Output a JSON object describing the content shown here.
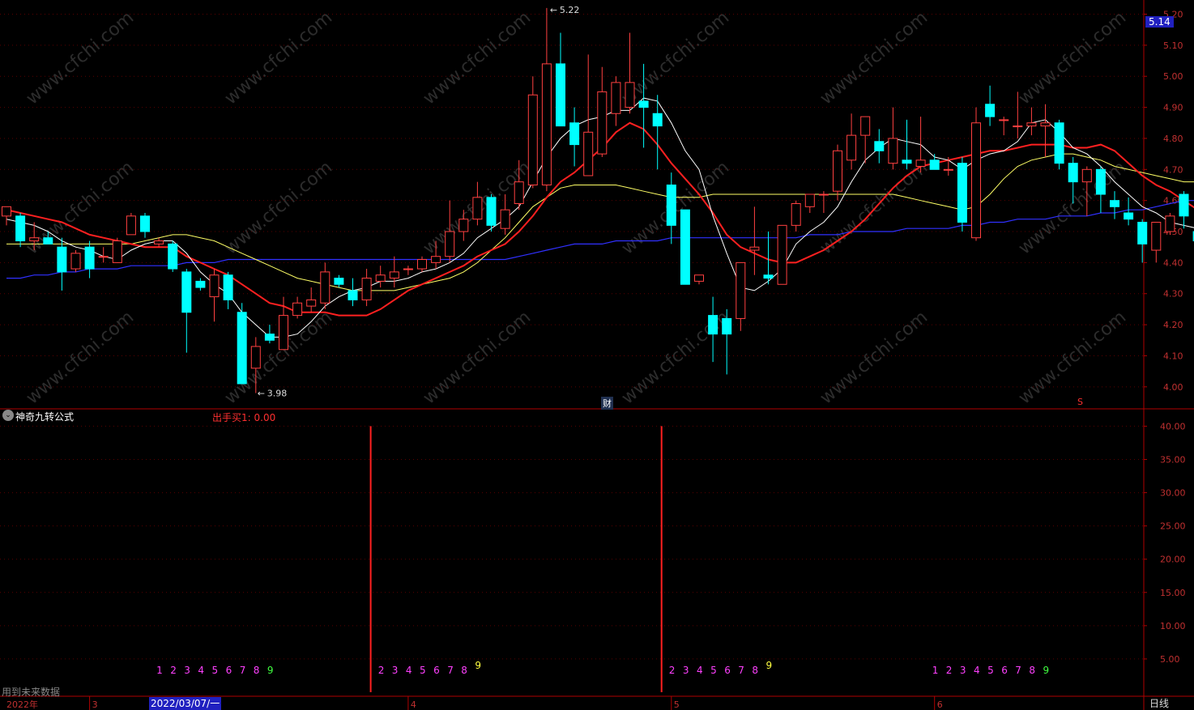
{
  "app": {
    "indicator_name": "神奇九转公式",
    "indicator_value_label": "出手买1:",
    "indicator_value": "0.00",
    "future_data_note": "用到未来数据",
    "period": "日线",
    "cursor_date": "2022/03/07/一",
    "cursor_price": "5.14",
    "max_label": "5.22",
    "min_label": "3.98",
    "fin_marker": "财",
    "s_marker": "S"
  },
  "colors": {
    "background": "#000000",
    "up": "#ff4040",
    "down": "#00ffff",
    "ma5": "#ffffff",
    "ma10": "#ff2020",
    "ma20": "#ffff66",
    "ma60": "#3030ff",
    "axis": "#b00000",
    "watermark": "#2c2c2c"
  },
  "watermark": "www.cfchi.com",
  "chart_data": {
    "type": "candlestick",
    "price_axis": {
      "min": 3.95,
      "max": 5.23,
      "ticks": [
        "4.00",
        "4.10",
        "4.20",
        "4.30",
        "4.40",
        "4.50",
        "4.60",
        "4.70",
        "4.80",
        "4.90",
        "5.00",
        "5.10",
        "5.20"
      ]
    },
    "indicator_axis": {
      "min": 0,
      "max": 42,
      "ticks": [
        "5.00",
        "10.00",
        "15.00",
        "20.00",
        "25.00",
        "30.00",
        "35.00",
        "40.00"
      ]
    },
    "x_labels": [
      "2022年",
      "3",
      "4",
      "5",
      "6"
    ],
    "candles": [
      {
        "o": 4.55,
        "h": 4.58,
        "l": 4.52,
        "c": 4.58
      },
      {
        "o": 4.55,
        "h": 4.56,
        "l": 4.45,
        "c": 4.47
      },
      {
        "o": 4.47,
        "h": 4.53,
        "l": 4.44,
        "c": 4.48
      },
      {
        "o": 4.48,
        "h": 4.5,
        "l": 4.46,
        "c": 4.46
      },
      {
        "o": 4.45,
        "h": 4.48,
        "l": 4.31,
        "c": 4.37
      },
      {
        "o": 4.38,
        "h": 4.44,
        "l": 4.37,
        "c": 4.43
      },
      {
        "o": 4.45,
        "h": 4.47,
        "l": 4.35,
        "c": 4.38
      },
      {
        "o": 4.42,
        "h": 4.45,
        "l": 4.4,
        "c": 4.42
      },
      {
        "o": 4.4,
        "h": 4.48,
        "l": 4.4,
        "c": 4.47
      },
      {
        "o": 4.49,
        "h": 4.56,
        "l": 4.49,
        "c": 4.55
      },
      {
        "o": 4.55,
        "h": 4.56,
        "l": 4.48,
        "c": 4.5
      },
      {
        "o": 4.46,
        "h": 4.48,
        "l": 4.45,
        "c": 4.47
      },
      {
        "o": 4.46,
        "h": 4.47,
        "l": 4.37,
        "c": 4.38
      },
      {
        "o": 4.37,
        "h": 4.38,
        "l": 4.11,
        "c": 4.24
      },
      {
        "o": 4.34,
        "h": 4.35,
        "l": 4.31,
        "c": 4.32
      },
      {
        "o": 4.29,
        "h": 4.38,
        "l": 4.21,
        "c": 4.36
      },
      {
        "o": 4.36,
        "h": 4.37,
        "l": 4.25,
        "c": 4.28
      },
      {
        "o": 4.24,
        "h": 4.27,
        "l": 4.01,
        "c": 4.01
      },
      {
        "o": 4.06,
        "h": 4.16,
        "l": 3.98,
        "c": 4.13
      },
      {
        "o": 4.17,
        "h": 4.2,
        "l": 4.14,
        "c": 4.15
      },
      {
        "o": 4.12,
        "h": 4.29,
        "l": 4.12,
        "c": 4.23
      },
      {
        "o": 4.23,
        "h": 4.29,
        "l": 4.22,
        "c": 4.27
      },
      {
        "o": 4.26,
        "h": 4.32,
        "l": 4.24,
        "c": 4.28
      },
      {
        "o": 4.27,
        "h": 4.4,
        "l": 4.25,
        "c": 4.37
      },
      {
        "o": 4.35,
        "h": 4.36,
        "l": 4.32,
        "c": 4.33
      },
      {
        "o": 4.31,
        "h": 4.35,
        "l": 4.26,
        "c": 4.28
      },
      {
        "o": 4.28,
        "h": 4.38,
        "l": 4.26,
        "c": 4.35
      },
      {
        "o": 4.34,
        "h": 4.39,
        "l": 4.32,
        "c": 4.36
      },
      {
        "o": 4.35,
        "h": 4.42,
        "l": 4.32,
        "c": 4.37
      },
      {
        "o": 4.38,
        "h": 4.39,
        "l": 4.36,
        "c": 4.38
      },
      {
        "o": 4.38,
        "h": 4.42,
        "l": 4.37,
        "c": 4.41
      },
      {
        "o": 4.4,
        "h": 4.47,
        "l": 4.38,
        "c": 4.42
      },
      {
        "o": 4.42,
        "h": 4.6,
        "l": 4.4,
        "c": 4.5
      },
      {
        "o": 4.5,
        "h": 4.57,
        "l": 4.47,
        "c": 4.54
      },
      {
        "o": 4.54,
        "h": 4.66,
        "l": 4.52,
        "c": 4.61
      },
      {
        "o": 4.61,
        "h": 4.62,
        "l": 4.5,
        "c": 4.52
      },
      {
        "o": 4.51,
        "h": 4.62,
        "l": 4.49,
        "c": 4.57
      },
      {
        "o": 4.59,
        "h": 4.73,
        "l": 4.57,
        "c": 4.66
      },
      {
        "o": 4.65,
        "h": 5.0,
        "l": 4.64,
        "c": 4.94
      },
      {
        "o": 4.65,
        "h": 5.22,
        "l": 4.63,
        "c": 5.04
      },
      {
        "o": 5.04,
        "h": 5.14,
        "l": 4.85,
        "c": 4.84
      },
      {
        "o": 4.85,
        "h": 4.9,
        "l": 4.71,
        "c": 4.78
      },
      {
        "o": 4.68,
        "h": 5.07,
        "l": 4.68,
        "c": 4.82
      },
      {
        "o": 4.75,
        "h": 5.03,
        "l": 4.74,
        "c": 4.95
      },
      {
        "o": 4.88,
        "h": 5.0,
        "l": 4.84,
        "c": 4.98
      },
      {
        "o": 4.9,
        "h": 5.14,
        "l": 4.88,
        "c": 4.98
      },
      {
        "o": 4.92,
        "h": 5.04,
        "l": 4.77,
        "c": 4.9
      },
      {
        "o": 4.88,
        "h": 4.94,
        "l": 4.7,
        "c": 4.84
      },
      {
        "o": 4.65,
        "h": 4.69,
        "l": 4.46,
        "c": 4.52
      },
      {
        "o": 4.57,
        "h": 4.57,
        "l": 4.33,
        "c": 4.33
      },
      {
        "o": 4.34,
        "h": 4.36,
        "l": 4.33,
        "c": 4.36
      },
      {
        "o": 4.23,
        "h": 4.29,
        "l": 4.08,
        "c": 4.17
      },
      {
        "o": 4.22,
        "h": 4.25,
        "l": 4.04,
        "c": 4.17
      },
      {
        "o": 4.22,
        "h": 4.4,
        "l": 4.18,
        "c": 4.4
      },
      {
        "o": 4.44,
        "h": 4.58,
        "l": 4.36,
        "c": 4.45
      },
      {
        "o": 4.36,
        "h": 4.5,
        "l": 4.33,
        "c": 4.35
      },
      {
        "o": 4.33,
        "h": 4.52,
        "l": 4.33,
        "c": 4.52
      },
      {
        "o": 4.52,
        "h": 4.6,
        "l": 4.5,
        "c": 4.59
      },
      {
        "o": 4.58,
        "h": 4.62,
        "l": 4.56,
        "c": 4.62
      },
      {
        "o": 4.62,
        "h": 4.63,
        "l": 4.56,
        "c": 4.62
      },
      {
        "o": 4.63,
        "h": 4.78,
        "l": 4.6,
        "c": 4.76
      },
      {
        "o": 4.73,
        "h": 4.88,
        "l": 4.7,
        "c": 4.81
      },
      {
        "o": 4.81,
        "h": 4.87,
        "l": 4.72,
        "c": 4.87
      },
      {
        "o": 4.79,
        "h": 4.83,
        "l": 4.72,
        "c": 4.76
      },
      {
        "o": 4.72,
        "h": 4.9,
        "l": 4.7,
        "c": 4.8
      },
      {
        "o": 4.73,
        "h": 4.86,
        "l": 4.7,
        "c": 4.72
      },
      {
        "o": 4.71,
        "h": 4.87,
        "l": 4.69,
        "c": 4.73
      },
      {
        "o": 4.73,
        "h": 4.75,
        "l": 4.7,
        "c": 4.7
      },
      {
        "o": 4.7,
        "h": 4.74,
        "l": 4.68,
        "c": 4.7
      },
      {
        "o": 4.72,
        "h": 4.74,
        "l": 4.5,
        "c": 4.53
      },
      {
        "o": 4.48,
        "h": 4.9,
        "l": 4.47,
        "c": 4.85
      },
      {
        "o": 4.91,
        "h": 4.97,
        "l": 4.84,
        "c": 4.87
      },
      {
        "o": 4.86,
        "h": 4.87,
        "l": 4.81,
        "c": 4.86
      },
      {
        "o": 4.84,
        "h": 4.95,
        "l": 4.8,
        "c": 4.84
      },
      {
        "o": 4.84,
        "h": 4.9,
        "l": 4.81,
        "c": 4.85
      },
      {
        "o": 4.84,
        "h": 4.91,
        "l": 4.74,
        "c": 4.85
      },
      {
        "o": 4.85,
        "h": 4.86,
        "l": 4.7,
        "c": 4.72
      },
      {
        "o": 4.72,
        "h": 4.74,
        "l": 4.59,
        "c": 4.66
      },
      {
        "o": 4.66,
        "h": 4.71,
        "l": 4.55,
        "c": 4.7
      },
      {
        "o": 4.7,
        "h": 4.71,
        "l": 4.56,
        "c": 4.62
      },
      {
        "o": 4.6,
        "h": 4.63,
        "l": 4.54,
        "c": 4.58
      },
      {
        "o": 4.56,
        "h": 4.61,
        "l": 4.52,
        "c": 4.54
      },
      {
        "o": 4.53,
        "h": 4.54,
        "l": 4.4,
        "c": 4.46
      },
      {
        "o": 4.44,
        "h": 4.53,
        "l": 4.4,
        "c": 4.53
      },
      {
        "o": 4.5,
        "h": 4.56,
        "l": 4.49,
        "c": 4.55
      },
      {
        "o": 4.62,
        "h": 4.63,
        "l": 4.51,
        "c": 4.55
      },
      {
        "o": 4.5,
        "h": 4.53,
        "l": 4.47,
        "c": 4.47
      }
    ],
    "ma5": [
      4.54,
      4.53,
      4.52,
      4.5,
      4.47,
      4.45,
      4.44,
      4.42,
      4.41,
      4.44,
      4.46,
      4.47,
      4.47,
      4.43,
      4.37,
      4.33,
      4.3,
      4.24,
      4.2,
      4.16,
      4.16,
      4.17,
      4.21,
      4.26,
      4.29,
      4.31,
      4.32,
      4.34,
      4.34,
      4.35,
      4.37,
      4.38,
      4.4,
      4.43,
      4.48,
      4.51,
      4.54,
      4.58,
      4.66,
      4.74,
      4.8,
      4.84,
      4.86,
      4.87,
      4.89,
      4.89,
      4.93,
      4.92,
      4.85,
      4.76,
      4.7,
      4.55,
      4.43,
      4.32,
      4.31,
      4.34,
      4.38,
      4.46,
      4.5,
      4.53,
      4.58,
      4.66,
      4.73,
      4.77,
      4.8,
      4.79,
      4.78,
      4.74,
      4.73,
      4.7,
      4.73,
      4.75,
      4.76,
      4.79,
      4.85,
      4.86,
      4.82,
      4.77,
      4.75,
      4.71,
      4.66,
      4.62,
      4.58,
      4.56,
      4.53,
      4.52,
      4.51
    ],
    "ma10": [
      4.57,
      4.56,
      4.55,
      4.54,
      4.53,
      4.51,
      4.49,
      4.48,
      4.47,
      4.46,
      4.45,
      4.45,
      4.45,
      4.42,
      4.4,
      4.38,
      4.36,
      4.33,
      4.3,
      4.27,
      4.26,
      4.24,
      4.24,
      4.24,
      4.23,
      4.23,
      4.23,
      4.25,
      4.28,
      4.31,
      4.33,
      4.35,
      4.37,
      4.39,
      4.42,
      4.44,
      4.46,
      4.5,
      4.55,
      4.61,
      4.66,
      4.69,
      4.73,
      4.77,
      4.82,
      4.85,
      4.83,
      4.78,
      4.72,
      4.67,
      4.62,
      4.56,
      4.49,
      4.45,
      4.43,
      4.41,
      4.4,
      4.4,
      4.42,
      4.44,
      4.47,
      4.5,
      4.54,
      4.59,
      4.64,
      4.68,
      4.71,
      4.72,
      4.73,
      4.74,
      4.75,
      4.76,
      4.76,
      4.77,
      4.78,
      4.78,
      4.78,
      4.77,
      4.77,
      4.78,
      4.76,
      4.72,
      4.68,
      4.65,
      4.63,
      4.6,
      4.57
    ],
    "ma20": [
      4.46,
      4.46,
      4.46,
      4.46,
      4.46,
      4.46,
      4.46,
      4.46,
      4.46,
      4.46,
      4.47,
      4.48,
      4.49,
      4.49,
      4.48,
      4.47,
      4.45,
      4.43,
      4.41,
      4.39,
      4.37,
      4.35,
      4.34,
      4.33,
      4.32,
      4.31,
      4.31,
      4.31,
      4.31,
      4.32,
      4.33,
      4.34,
      4.35,
      4.37,
      4.4,
      4.44,
      4.48,
      4.53,
      4.58,
      4.61,
      4.64,
      4.65,
      4.65,
      4.65,
      4.65,
      4.64,
      4.63,
      4.62,
      4.61,
      4.61,
      4.61,
      4.62,
      4.62,
      4.62,
      4.62,
      4.62,
      4.62,
      4.62,
      4.62,
      4.62,
      4.62,
      4.62,
      4.62,
      4.62,
      4.62,
      4.61,
      4.6,
      4.59,
      4.58,
      4.57,
      4.58,
      4.62,
      4.67,
      4.71,
      4.73,
      4.74,
      4.75,
      4.75,
      4.74,
      4.73,
      4.71,
      4.7,
      4.69,
      4.68,
      4.67,
      4.66,
      4.66
    ],
    "ma60": [
      4.35,
      4.35,
      4.36,
      4.36,
      4.37,
      4.37,
      4.38,
      4.38,
      4.38,
      4.39,
      4.39,
      4.39,
      4.39,
      4.4,
      4.4,
      4.4,
      4.41,
      4.41,
      4.41,
      4.41,
      4.41,
      4.41,
      4.41,
      4.41,
      4.41,
      4.41,
      4.41,
      4.41,
      4.41,
      4.41,
      4.41,
      4.41,
      4.41,
      4.41,
      4.41,
      4.41,
      4.41,
      4.42,
      4.43,
      4.44,
      4.45,
      4.46,
      4.46,
      4.46,
      4.47,
      4.47,
      4.47,
      4.47,
      4.48,
      4.48,
      4.48,
      4.48,
      4.48,
      4.48,
      4.48,
      4.48,
      4.48,
      4.48,
      4.49,
      4.49,
      4.49,
      4.5,
      4.5,
      4.5,
      4.5,
      4.51,
      4.51,
      4.51,
      4.51,
      4.52,
      4.52,
      4.53,
      4.53,
      4.54,
      4.54,
      4.54,
      4.55,
      4.55,
      4.55,
      4.56,
      4.56,
      4.57,
      4.57,
      4.58,
      4.59,
      4.6,
      4.6
    ],
    "signal_bars": [
      {
        "index": 26,
        "value": 40
      },
      {
        "index": 47,
        "value": 40
      }
    ],
    "nine_count_sequences": [
      {
        "start": 11,
        "labels": [
          "1",
          "2",
          "3",
          "4",
          "5",
          "6",
          "7",
          "8",
          "9"
        ]
      },
      {
        "start": 27,
        "labels": [
          "2",
          "3",
          "4",
          "5",
          "6",
          "7",
          "8",
          "9"
        ]
      },
      {
        "start": 48,
        "labels": [
          "2",
          "3",
          "4",
          "5",
          "6",
          "7",
          "8",
          "9"
        ]
      },
      {
        "start": 67,
        "labels": [
          "1",
          "2",
          "3",
          "4",
          "5",
          "6",
          "7",
          "8",
          "9"
        ]
      }
    ],
    "month_marks": [
      {
        "index": 6,
        "label": "3"
      },
      {
        "index": 29,
        "label": "4"
      },
      {
        "index": 48,
        "label": "5"
      },
      {
        "index": 67,
        "label": "6"
      }
    ]
  }
}
